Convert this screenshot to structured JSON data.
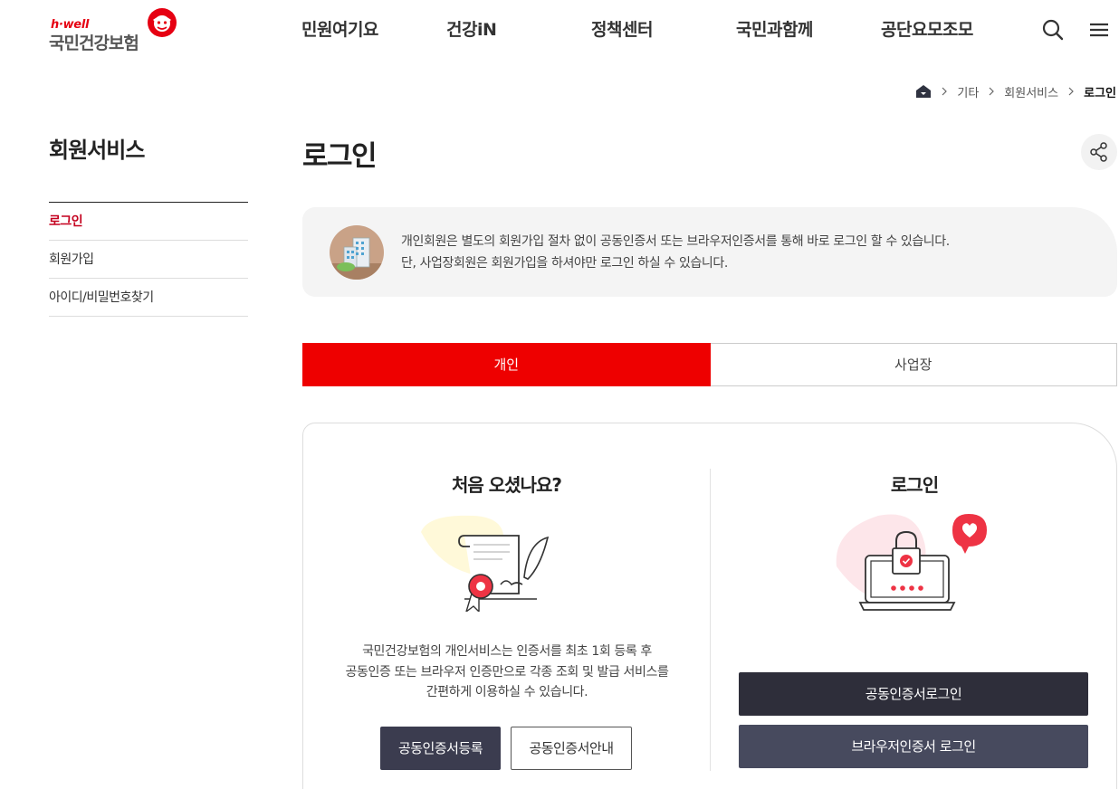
{
  "logo": {
    "tagline": "h·well",
    "name": "국민건강보험"
  },
  "gnb": [
    "민원여기요",
    "건강iN",
    "정책센터",
    "국민과함께",
    "공단요모조모"
  ],
  "header_icons": {
    "search": "search-icon",
    "menu": "hamburger-menu-icon"
  },
  "breadcrumb": {
    "home": "home-icon",
    "items": [
      "기타",
      "회원서비스"
    ],
    "current": "로그인"
  },
  "sidebar": {
    "title": "회원서비스",
    "items": [
      {
        "label": "로그인"
      },
      {
        "label": "회원가입"
      },
      {
        "label": "아이디/비밀번호찾기"
      }
    ]
  },
  "main": {
    "title": "로그인",
    "share_icon": "share-icon",
    "notice": {
      "line1": "개인회원은 별도의 회원가입 절차 없이 공동인증서 또는 브라우저인증서를 통해 바로 로그인 할 수 있습니다.",
      "line2": "단, 사업장회원은 회원가입을 하셔야만 로그인 하실 수 있습니다."
    },
    "tabs": [
      {
        "label": "개인"
      },
      {
        "label": "사업장"
      }
    ],
    "left": {
      "title": "처음 오셨나요?",
      "desc1": "국민건강보험의 개인서비스는 인증서를 최초 1회 등록 후",
      "desc2": "공동인증 또는 브라우저 인증만으로 각종 조회 및 발급 서비스를",
      "desc3": "간편하게 이용하실 수 있습니다.",
      "btn_register": "공동인증서등록",
      "btn_guide": "공동인증서안내"
    },
    "right": {
      "title": "로그인",
      "btn_cert_login": "공동인증서로그인",
      "btn_browser_login": "브라우저인증서 로그인"
    }
  },
  "colors": {
    "accent": "#ee0000",
    "active_menu": "#c4001e",
    "button_dark": "#3b3c4f"
  }
}
